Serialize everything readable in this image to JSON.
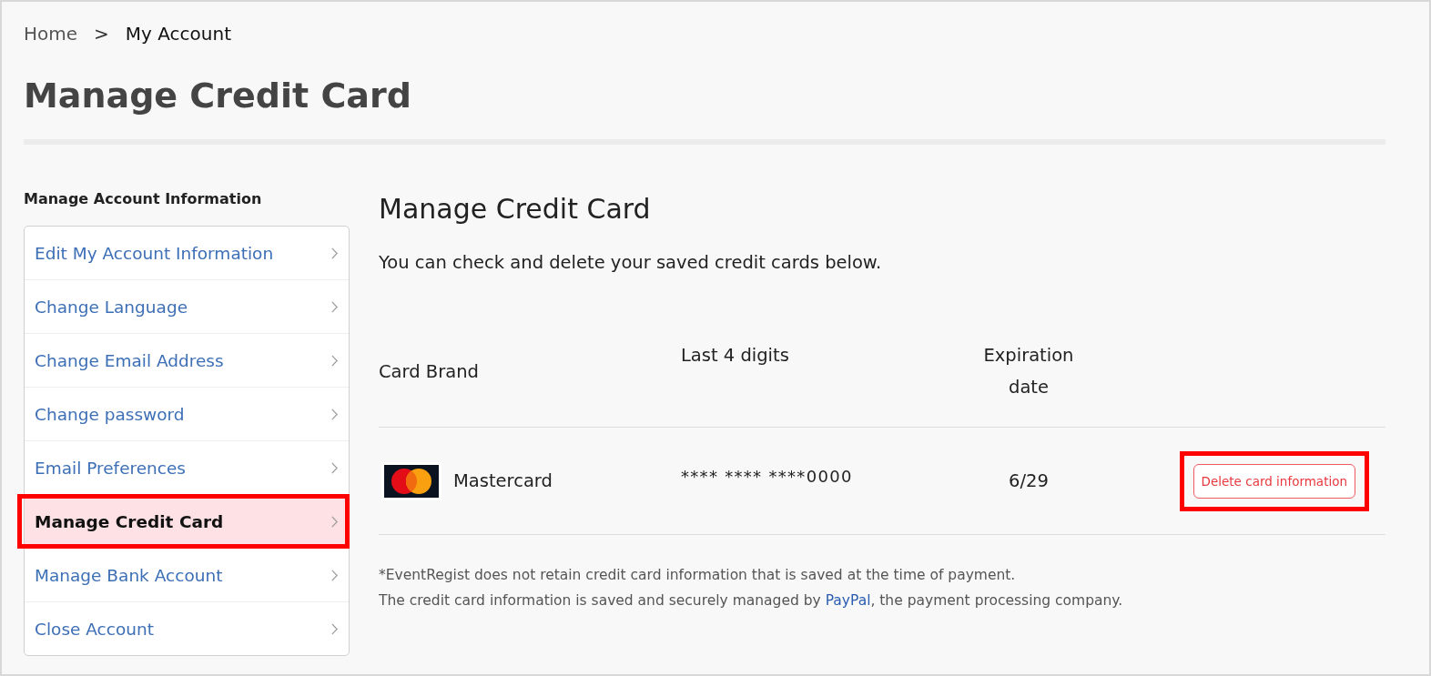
{
  "breadcrumb": [
    {
      "label": "Home",
      "kind": "link"
    },
    {
      "label": ">",
      "kind": "separator"
    },
    {
      "label": "My Account",
      "kind": "current"
    }
  ],
  "page_title": "Manage Credit Card",
  "sidebar": {
    "heading": "Manage Account Information",
    "items": [
      {
        "label": "Edit My Account Information",
        "selected": false,
        "highlighted": false
      },
      {
        "label": "Change Language",
        "selected": false,
        "highlighted": false
      },
      {
        "label": "Change Email Address",
        "selected": false,
        "highlighted": false
      },
      {
        "label": "Change password",
        "selected": false,
        "highlighted": false
      },
      {
        "label": "Email Preferences",
        "selected": false,
        "highlighted": false
      },
      {
        "label": "Manage Credit Card",
        "selected": true,
        "highlighted": true
      },
      {
        "label": "Manage Bank Account",
        "selected": false,
        "highlighted": false
      },
      {
        "label": "Close Account",
        "selected": false,
        "highlighted": false
      }
    ]
  },
  "main": {
    "heading": "Manage Credit Card",
    "intro": "You can check and delete your saved credit cards below.",
    "table": {
      "columns": [
        "Card Brand",
        "Last 4 digits",
        "Expiration date"
      ],
      "rows": [
        {
          "brand": "Mastercard",
          "number": "**** **** ****0000",
          "expiry": "6/29",
          "action": {
            "label": "Delete card information",
            "highlighted": true
          }
        }
      ]
    },
    "notes": [
      {
        "text": "*EventRegist does not retain credit card information that is saved at the time of payment."
      },
      {
        "text": "The credit card information is saved and securely managed by ",
        "link": "PayPal",
        "after": ", the payment processing company."
      }
    ]
  }
}
